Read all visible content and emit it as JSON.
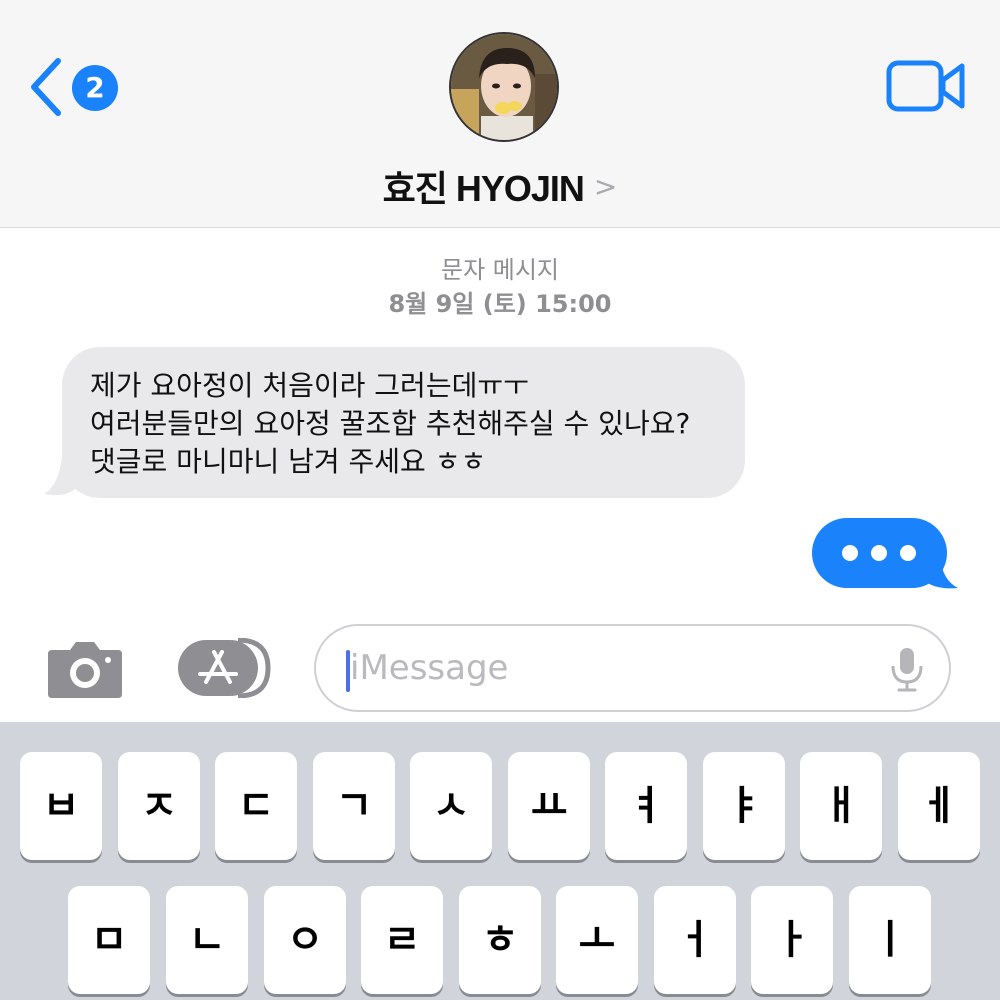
{
  "header": {
    "back_badge": "2",
    "contact_name": "효진 HYOJIN",
    "chevron": ">"
  },
  "conversation": {
    "service_label": "문자 메시지",
    "timestamp": "8월 9일 (토) 15:00",
    "incoming_lines": [
      "제가 요아정이 처음이라 그러는데ㅠㅜ",
      "여러분들만의 요아정 꿀조합 추천해주실 수 있나요?",
      "댓글로 마니마니 남겨 주세요 ㅎㅎ"
    ]
  },
  "input": {
    "placeholder": "iMessage"
  },
  "keyboard": {
    "row1": [
      "ㅂ",
      "ㅈ",
      "ㄷ",
      "ㄱ",
      "ㅅ",
      "ㅛ",
      "ㅕ",
      "ㅑ",
      "ㅐ",
      "ㅔ"
    ],
    "row2": [
      "ㅁ",
      "ㄴ",
      "ㅇ",
      "ㄹ",
      "ㅎ",
      "ㅗ",
      "ㅓ",
      "ㅏ",
      "ㅣ"
    ]
  },
  "colors": {
    "accent": "#1a82fb",
    "incoming_bubble": "#e9e9eb",
    "keyboard_bg": "#d1d4da"
  }
}
